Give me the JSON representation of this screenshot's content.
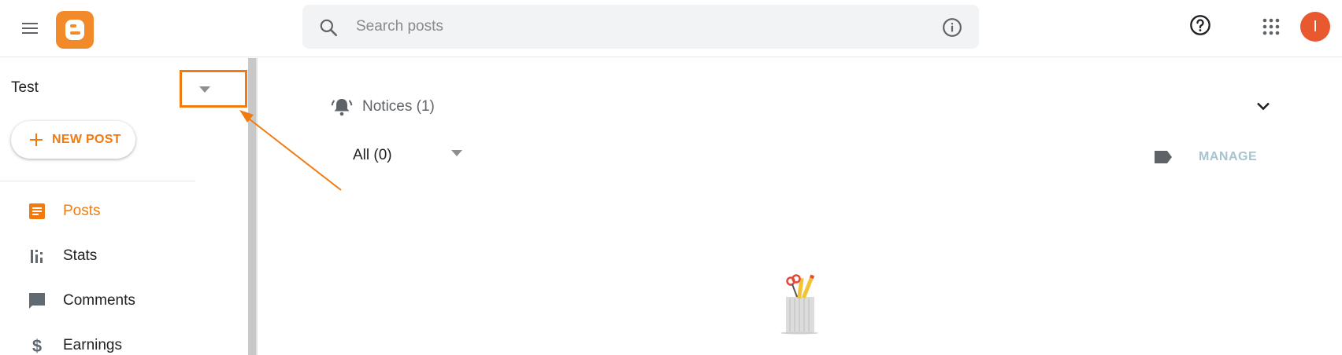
{
  "header": {
    "search": {
      "placeholder": "Search posts",
      "value": ""
    },
    "avatar_initial": "I",
    "icons": [
      "menu-icon",
      "blogger-logo-icon",
      "search-icon",
      "info-icon",
      "help-icon",
      "apps-grid-icon"
    ]
  },
  "sidebar": {
    "blog_name": "Test",
    "new_post_label": "NEW POST",
    "items": [
      {
        "label": "Posts",
        "icon": "posts-icon",
        "active": true
      },
      {
        "label": "Stats",
        "icon": "stats-icon",
        "active": false
      },
      {
        "label": "Comments",
        "icon": "comments-icon",
        "active": false
      },
      {
        "label": "Earnings",
        "icon": "earnings-icon",
        "active": false
      }
    ]
  },
  "main": {
    "notices_label": "Notices (1)",
    "filter_value": "All (0)",
    "manage_label": "MANAGE"
  },
  "colors": {
    "accent": "#f27b0f",
    "blogger_orange": "#f28a2a",
    "avatar_bg": "#e8592f",
    "manage_text": "#a6c4ce",
    "annotation": "#f27b0f"
  }
}
